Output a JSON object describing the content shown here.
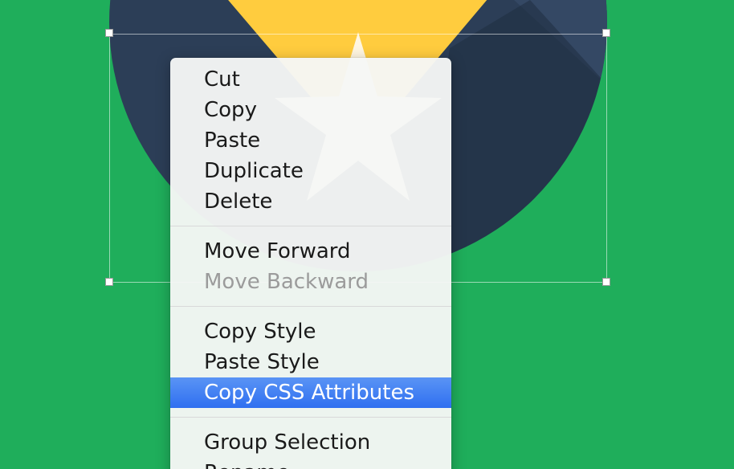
{
  "canvas": {
    "background_color": "#1fae5b",
    "artwork": {
      "circle_color": "#2c3e57",
      "shape_color": "#ffcf45",
      "star_color": "#fff8e6"
    }
  },
  "context_menu": {
    "groups": [
      {
        "items": [
          {
            "label": "Cut",
            "enabled": true
          },
          {
            "label": "Copy",
            "enabled": true
          },
          {
            "label": "Paste",
            "enabled": true
          },
          {
            "label": "Duplicate",
            "enabled": true
          },
          {
            "label": "Delete",
            "enabled": true
          }
        ]
      },
      {
        "items": [
          {
            "label": "Move Forward",
            "enabled": true
          },
          {
            "label": "Move Backward",
            "enabled": false
          }
        ]
      },
      {
        "items": [
          {
            "label": "Copy Style",
            "enabled": true
          },
          {
            "label": "Paste Style",
            "enabled": true
          },
          {
            "label": "Copy CSS Attributes",
            "enabled": true,
            "highlighted": true
          }
        ]
      },
      {
        "items": [
          {
            "label": "Group Selection",
            "enabled": true
          },
          {
            "label": "Rename",
            "enabled": true
          }
        ]
      }
    ],
    "highlight_color": "#3a7bf2"
  }
}
